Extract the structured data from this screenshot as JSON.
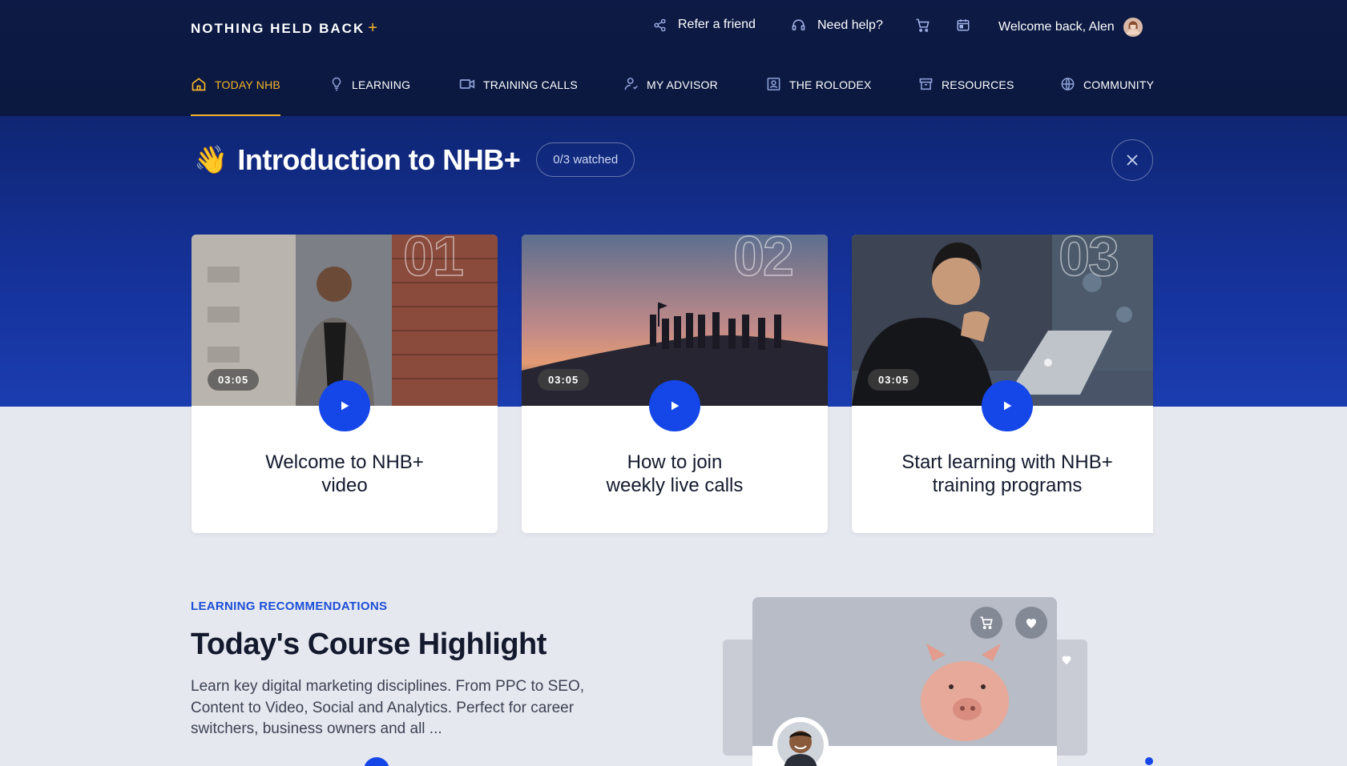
{
  "brand": {
    "name": "NOTHING HELD BACK",
    "plus": "+"
  },
  "utility": {
    "refer": "Refer a friend",
    "help": "Need help?",
    "welcome": "Welcome back, Alen"
  },
  "nav": [
    {
      "label": "TODAY NHB",
      "icon": "home-icon",
      "active": true
    },
    {
      "label": "LEARNING",
      "icon": "bulb-icon"
    },
    {
      "label": "TRAINING CALLS",
      "icon": "video-icon"
    },
    {
      "label": "MY ADVISOR",
      "icon": "person-icon"
    },
    {
      "label": "THE ROLODEX",
      "icon": "contacts-icon"
    },
    {
      "label": "RESOURCES",
      "icon": "box-icon"
    },
    {
      "label": "COMMUNITY",
      "icon": "globe-icon"
    }
  ],
  "intro": {
    "title": "Introduction to NHB+",
    "watched": "0/3 watched",
    "emoji": "👋"
  },
  "videos": [
    {
      "num": "01",
      "duration": "03:05",
      "title_l1": "Welcome to NHB+",
      "title_l2": "video"
    },
    {
      "num": "02",
      "duration": "03:05",
      "title_l1": "How to join",
      "title_l2": "weekly live calls"
    },
    {
      "num": "03",
      "duration": "03:05",
      "title_l1": "Start learning with NHB+",
      "title_l2": "training programs"
    }
  ],
  "recommend": {
    "eyebrow": "LEARNING RECOMMENDATIONS",
    "title": "Today's Course Highlight",
    "desc": "Learn key digital marketing disciplines. From PPC to SEO, Content to Video, Social and Analytics. Perfect for career switchers, business owners and all ..."
  },
  "colors": {
    "accent": "#f5b52a",
    "primary": "#1547e8",
    "navy": "#0b183f"
  }
}
